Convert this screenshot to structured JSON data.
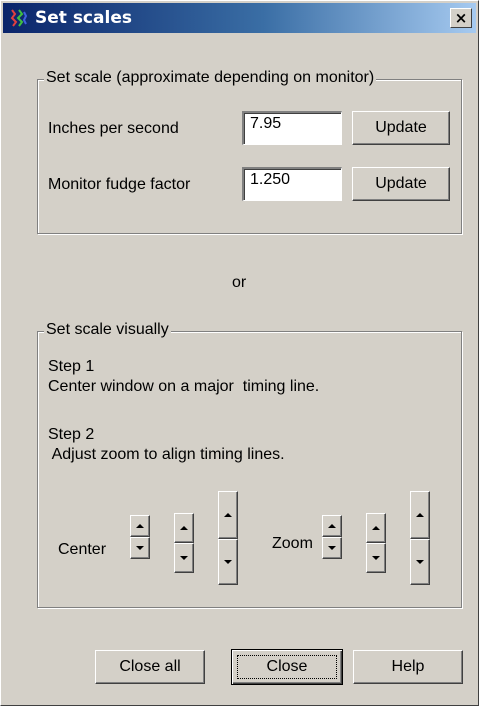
{
  "window": {
    "title": "Set scales",
    "close_glyph": "×"
  },
  "scale_group": {
    "legend": "Set scale (approximate depending on monitor)",
    "inches_label": "Inches per second",
    "inches_value": "7.95",
    "inches_update": "Update",
    "fudge_label": "Monitor fudge factor",
    "fudge_value": "1.250",
    "fudge_update": "Update"
  },
  "or_label": "or",
  "visual_group": {
    "legend": "Set scale visually",
    "step1_title": "Step 1",
    "step1_text": "Center window on a major  timing line.",
    "step2_title": "Step 2",
    "step2_text": " Adjust zoom to align timing lines.",
    "center_label": "Center",
    "zoom_label": "Zoom"
  },
  "footer": {
    "close_all": "Close all",
    "close": "Close",
    "help": "Help"
  },
  "icons": {
    "title_icon": "app-waveform-icon",
    "spin_up": "triangle-up-icon",
    "spin_down": "triangle-down-icon"
  }
}
